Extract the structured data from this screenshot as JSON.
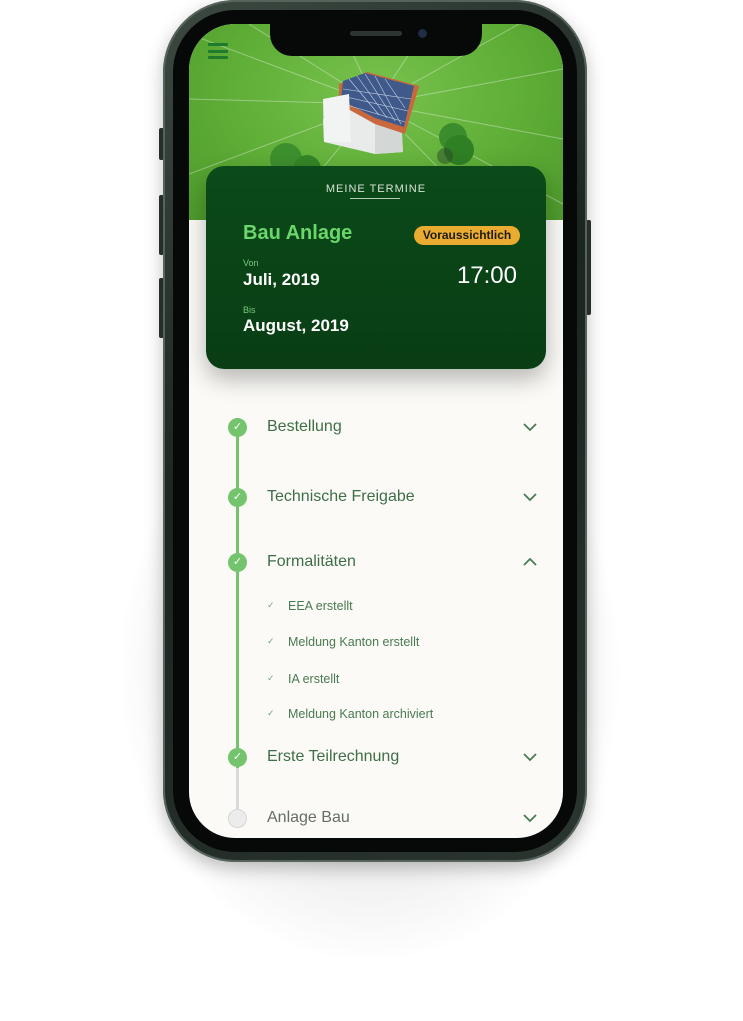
{
  "card": {
    "heading": "MEINE TERMINE",
    "title": "Bau Anlage",
    "status": "Voraussichtlich",
    "from_label": "Von",
    "from_value": "Juli, 2019",
    "until_label": "Bis",
    "until_value": "August, 2019",
    "time": "17:00"
  },
  "steps": [
    {
      "label": "Bestellung",
      "state": "done",
      "expanded": false
    },
    {
      "label": "Technische Freigabe",
      "state": "done",
      "expanded": false
    },
    {
      "label": "Formalitäten",
      "state": "done",
      "expanded": true,
      "subitems": [
        "EEA erstellt",
        "Meldung Kanton erstellt",
        "IA erstellt",
        "Meldung Kanton archiviert"
      ]
    },
    {
      "label": "Erste Teilrechnung",
      "state": "done",
      "expanded": false
    },
    {
      "label": "Anlage Bau",
      "state": "pending",
      "expanded": false
    }
  ],
  "icons": {
    "menu": "hamburger-menu-icon",
    "check": "check-icon",
    "expand": "chevron-down-icon",
    "collapse": "chevron-up-icon"
  },
  "colors": {
    "accent_green": "#74c46e",
    "card_bg": "#0b4a19",
    "title_green": "#6bd66b",
    "badge_bg": "#e9ac31"
  }
}
